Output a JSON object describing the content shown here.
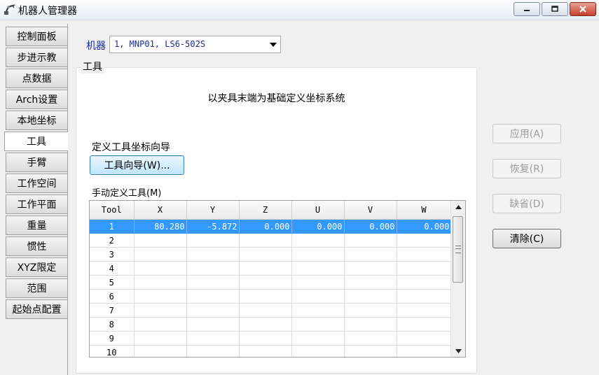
{
  "window": {
    "title": "机器人管理器"
  },
  "tabs": [
    {
      "label": "控制面板",
      "active": false
    },
    {
      "label": "步进示教",
      "active": false
    },
    {
      "label": "点数据",
      "active": false
    },
    {
      "label": "Arch设置",
      "active": false
    },
    {
      "label": "本地坐标",
      "active": false
    },
    {
      "label": "工具",
      "active": true
    },
    {
      "label": "手臂",
      "active": false
    },
    {
      "label": "工作空间",
      "active": false
    },
    {
      "label": "工作平面",
      "active": false
    },
    {
      "label": "重量",
      "active": false
    },
    {
      "label": "惯性",
      "active": false
    },
    {
      "label": "XYZ限定",
      "active": false
    },
    {
      "label": "范围",
      "active": false
    },
    {
      "label": "起始点配置",
      "active": false
    }
  ],
  "robot": {
    "label": "机器",
    "selected": "1, MNP01, LS6-502S"
  },
  "tool_group": {
    "title": "工具",
    "subtitle": "以夹具末端为基础定义坐标系统",
    "wizard_label": "定义工具坐标向导",
    "wizard_button": "工具向导(W)...",
    "manual_label": "手动定义工具(M)"
  },
  "grid": {
    "columns": [
      "Tool",
      "X",
      "Y",
      "Z",
      "U",
      "V",
      "W"
    ],
    "rows": [
      {
        "tool": "1",
        "x": "80.280",
        "y": "-5.872",
        "z": "0.000",
        "u": "0.000",
        "v": "0.000",
        "w": "0.000",
        "selected": true
      },
      {
        "tool": "2",
        "x": "",
        "y": "",
        "z": "",
        "u": "",
        "v": "",
        "w": ""
      },
      {
        "tool": "3",
        "x": "",
        "y": "",
        "z": "",
        "u": "",
        "v": "",
        "w": ""
      },
      {
        "tool": "4",
        "x": "",
        "y": "",
        "z": "",
        "u": "",
        "v": "",
        "w": ""
      },
      {
        "tool": "5",
        "x": "",
        "y": "",
        "z": "",
        "u": "",
        "v": "",
        "w": ""
      },
      {
        "tool": "6",
        "x": "",
        "y": "",
        "z": "",
        "u": "",
        "v": "",
        "w": ""
      },
      {
        "tool": "7",
        "x": "",
        "y": "",
        "z": "",
        "u": "",
        "v": "",
        "w": ""
      },
      {
        "tool": "8",
        "x": "",
        "y": "",
        "z": "",
        "u": "",
        "v": "",
        "w": ""
      },
      {
        "tool": "9",
        "x": "",
        "y": "",
        "z": "",
        "u": "",
        "v": "",
        "w": ""
      },
      {
        "tool": "10",
        "x": "",
        "y": "",
        "z": "",
        "u": "",
        "v": "",
        "w": ""
      }
    ]
  },
  "actions": {
    "apply": "应用(A)",
    "restore": "恢复(R)",
    "default": "缺省(D)",
    "clear": "清除(C)"
  },
  "colors": {
    "selection": "#3399ff",
    "label_blue": "#1a2d9c"
  }
}
